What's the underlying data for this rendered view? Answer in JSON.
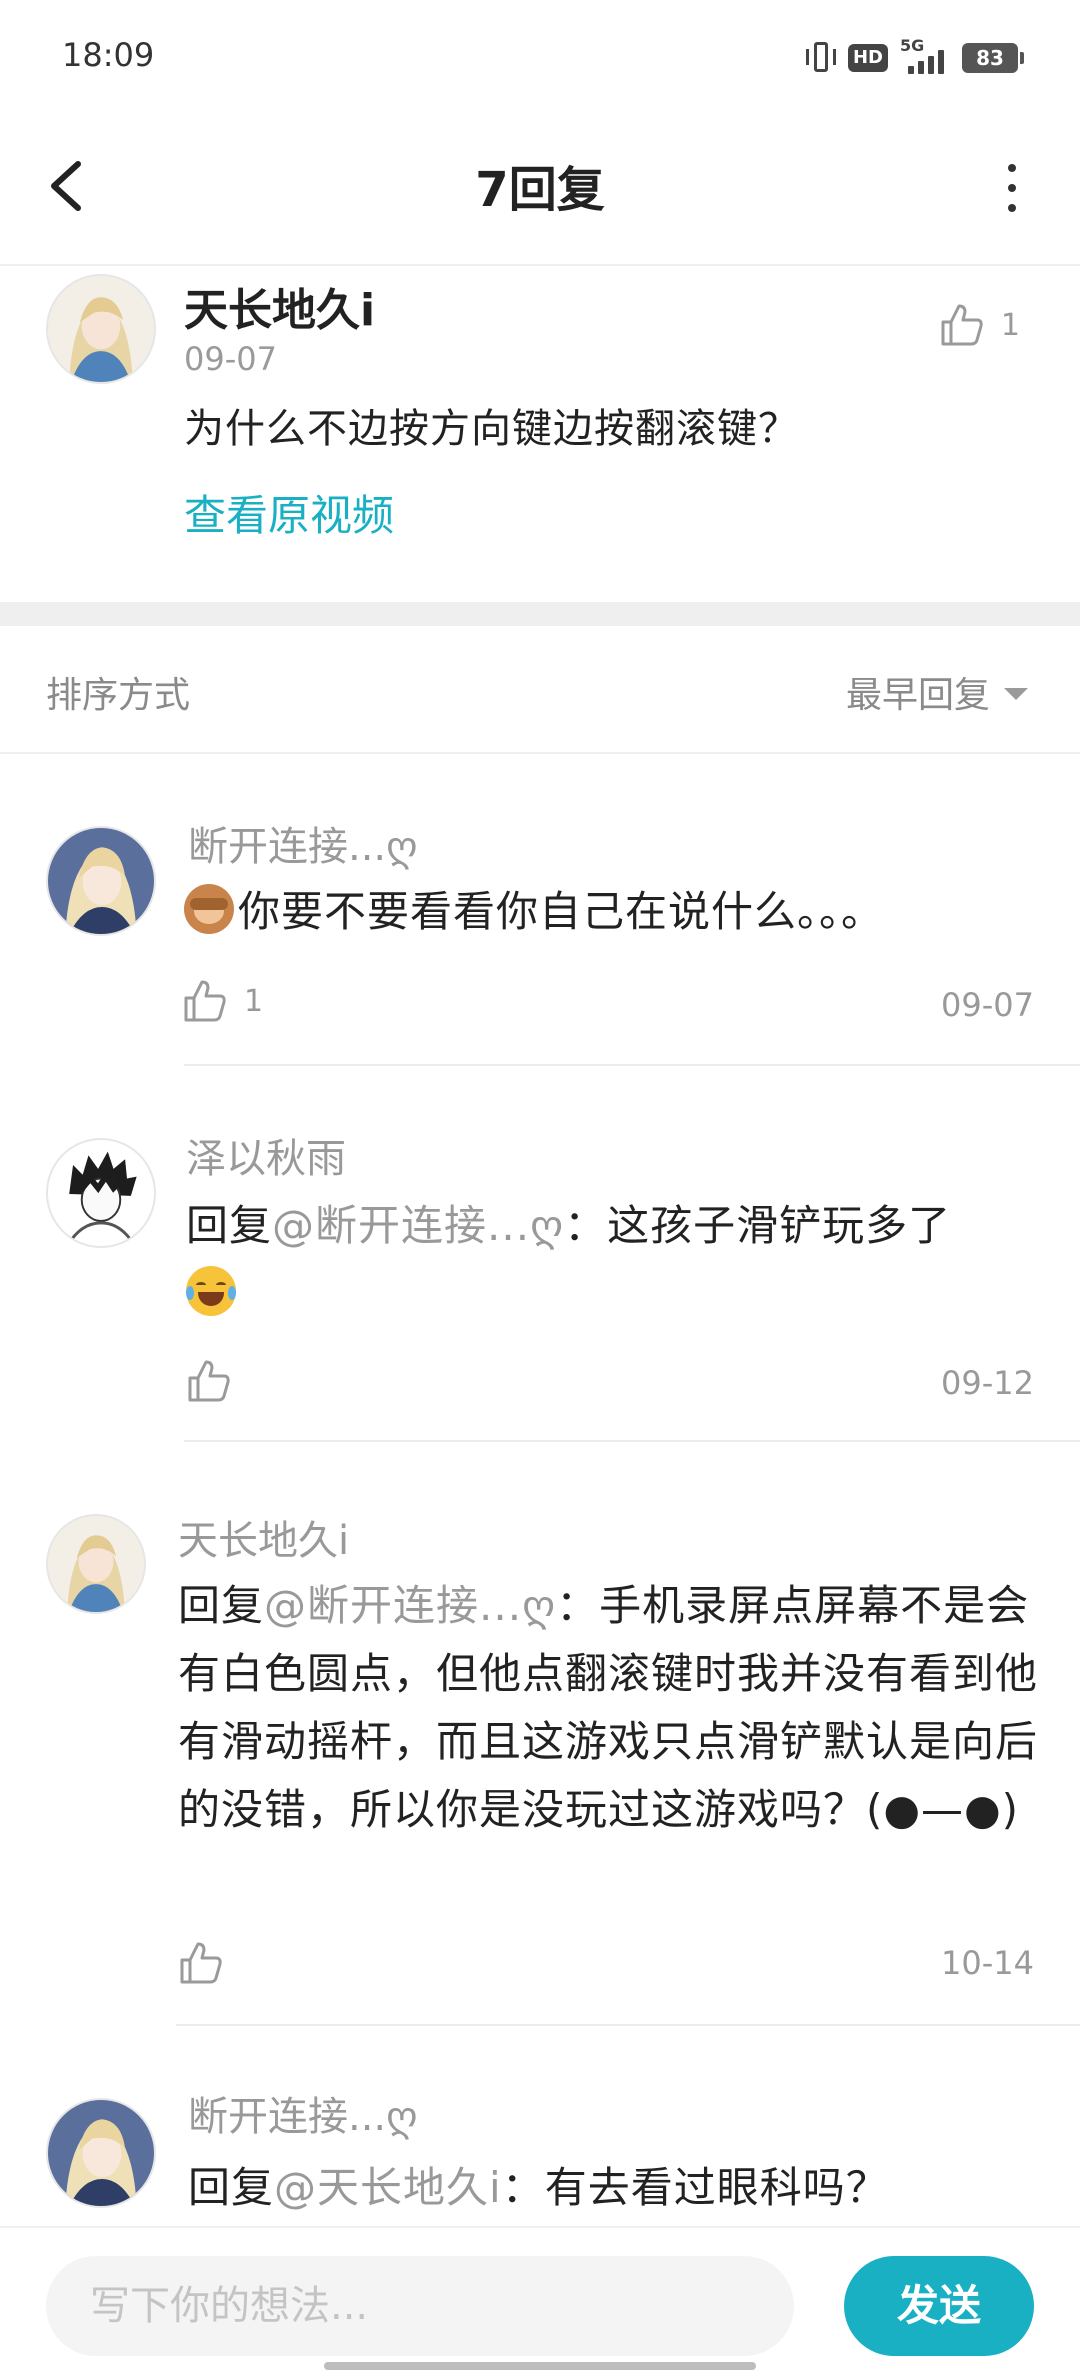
{
  "status_bar": {
    "time": "18:09",
    "network": "5G",
    "hd": "HD",
    "battery": "83"
  },
  "nav": {
    "title": "7回复"
  },
  "main_comment": {
    "username": "天长地久i",
    "date": "09-07",
    "text": "为什么不边按方向键边按翻滚键？",
    "like_count": "1",
    "view_link": "查看原视频"
  },
  "sort": {
    "label": "排序方式",
    "value": "最早回复"
  },
  "replies": [
    {
      "username": "断开连接...ღ",
      "text": "你要不要看看你自己在说什么。。。",
      "emoji": "see-no-evil-monkey",
      "like_count": "1",
      "date": "09-07"
    },
    {
      "username": "泽以秋雨",
      "prefix": "回复",
      "at": "@断开连接...ღ",
      "colon": "：",
      "text": "这孩子滑铲玩多了",
      "emoji": "tears-of-joy",
      "like_count": "",
      "date": "09-12"
    },
    {
      "username": "天长地久i",
      "prefix": "回复",
      "at": "@断开连接...ღ",
      "colon": "：",
      "text": "手机录屏点屏幕不是会有白色圆点，但他点翻滚键时我并没有看到他有滑动摇杆，而且这游戏只点滑铲默认是向后的没错，所以你是没玩过这游戏吗？(●—●)",
      "like_count": "",
      "date": "10-14"
    },
    {
      "username": "断开连接...ღ",
      "prefix": "回复",
      "at": "@天长地久i",
      "colon": "：",
      "text": "有去看过眼科吗？"
    }
  ],
  "bottom": {
    "input_placeholder": "写下你的想法...",
    "send_label": "发送"
  },
  "colors": {
    "accent": "#1ab0c4",
    "muted_text": "#999999",
    "divider": "#efefef"
  }
}
